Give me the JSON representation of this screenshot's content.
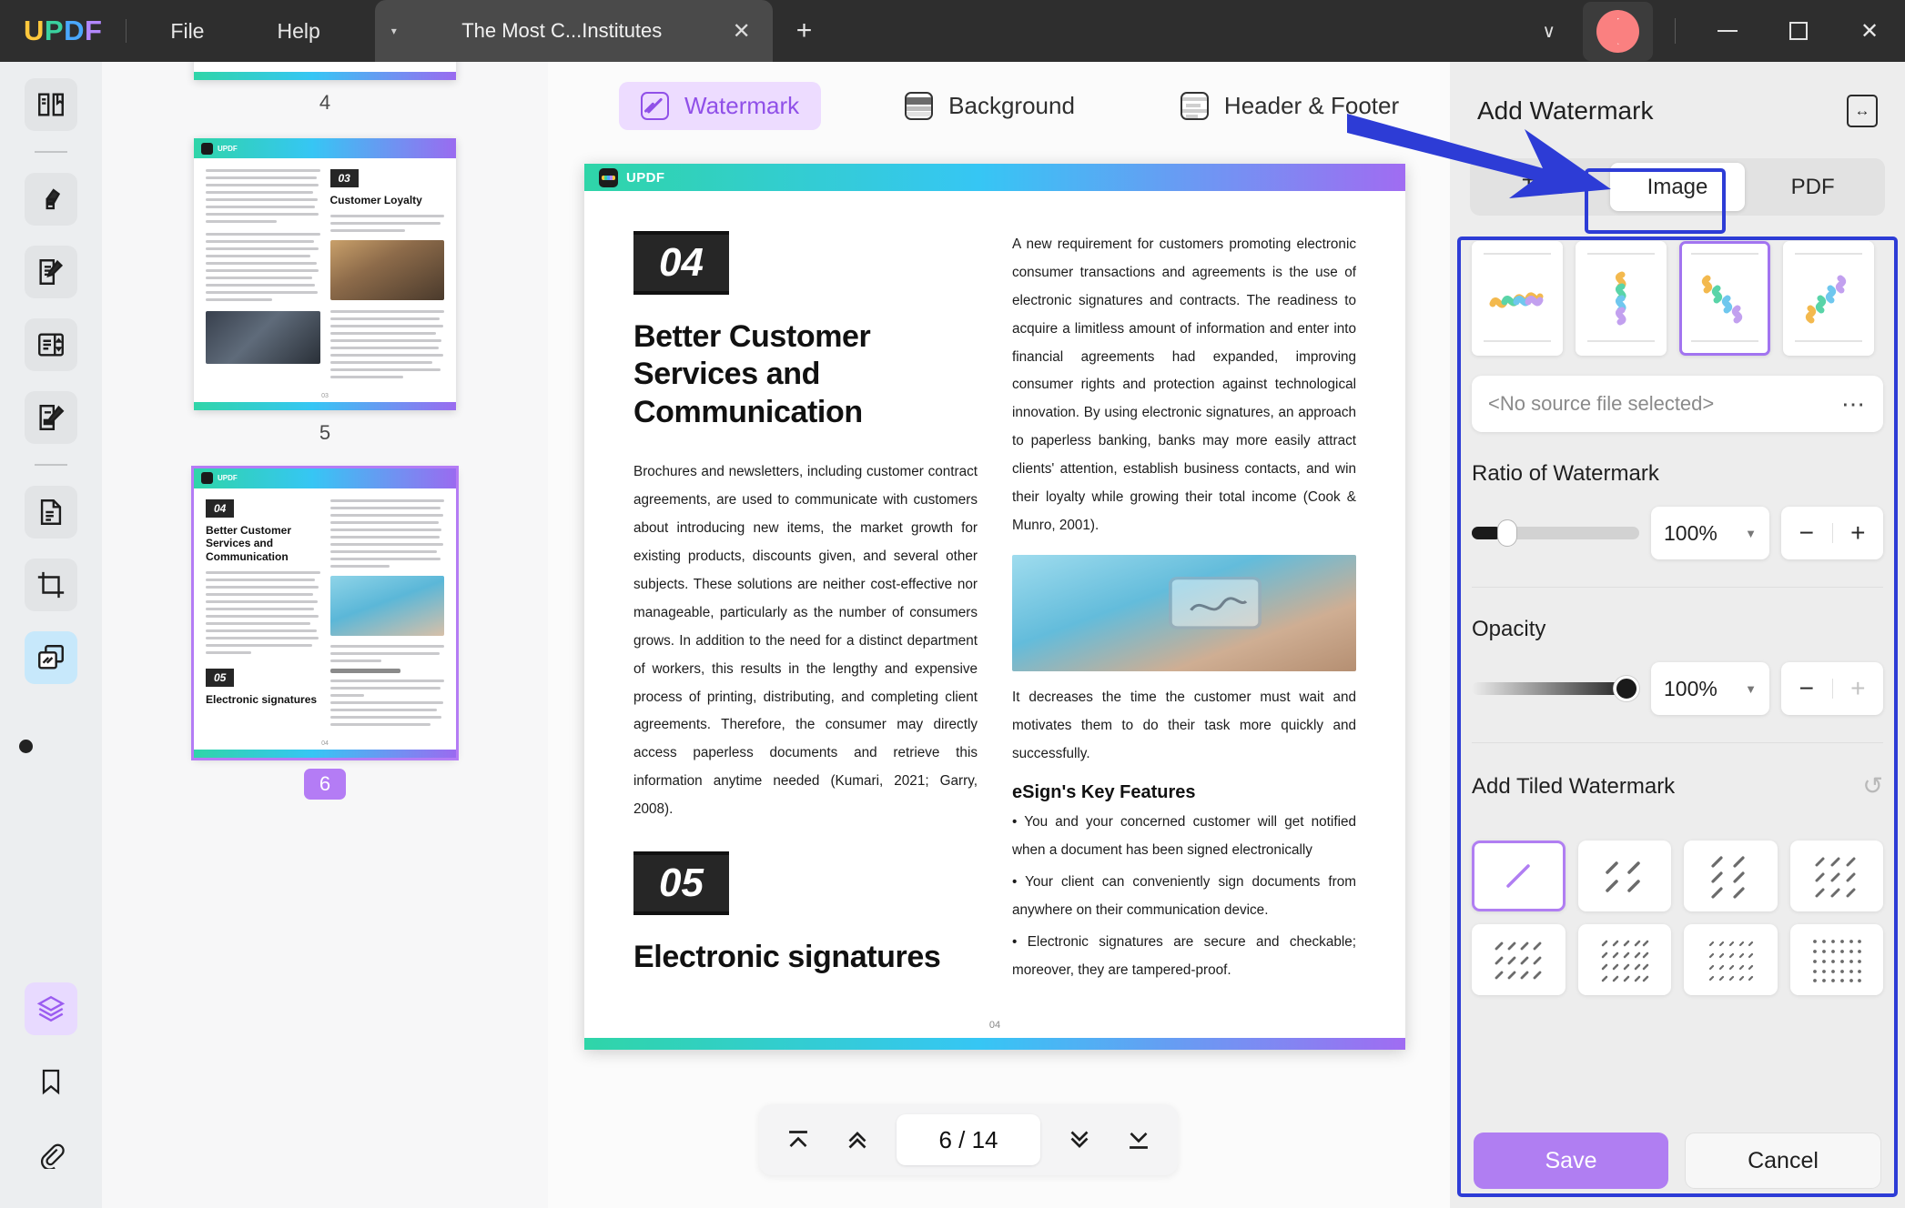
{
  "titlebar": {
    "logo": "UPDF",
    "menus": [
      "File",
      "Help"
    ],
    "tab": {
      "title": "The Most C...Institutes",
      "close": "✕",
      "caret": "▾"
    },
    "new_tab": "+",
    "chevron": "∨",
    "minimize": "—",
    "maximize": "□",
    "close": "✕"
  },
  "rail": {
    "items": [
      {
        "name": "reader-tool",
        "state": "idle"
      },
      {
        "name": "annotate-tool",
        "state": "idle"
      },
      {
        "name": "edit-pdf-tool",
        "state": "idle"
      },
      {
        "name": "form-tool",
        "state": "idle"
      },
      {
        "name": "sign-tool",
        "state": "idle"
      },
      {
        "name": "ocr-tool",
        "state": "idle"
      },
      {
        "name": "crop-tool",
        "state": "idle"
      },
      {
        "name": "page-watermark-tool",
        "state": "active"
      },
      {
        "name": "layers-tool",
        "state": "active"
      },
      {
        "name": "bookmark-tool",
        "state": "idle"
      },
      {
        "name": "attachment-tool",
        "state": "idle"
      }
    ]
  },
  "thumbnails": {
    "pages": [
      {
        "number": "4",
        "selected": false
      },
      {
        "number": "5",
        "selected": false,
        "badge": "03",
        "heading": "Customer Loyalty"
      },
      {
        "number": "6",
        "selected": true,
        "badge": "04",
        "heading": "Better Customer Services and Communication",
        "badge2": "05",
        "heading2": "Electronic signatures"
      }
    ]
  },
  "modebar": {
    "tabs": [
      {
        "label": "Watermark",
        "icon": "watermark-icon",
        "active": true
      },
      {
        "label": "Background",
        "icon": "background-icon",
        "active": false
      },
      {
        "label": "Header & Footer",
        "icon": "header-footer-icon",
        "active": false
      }
    ]
  },
  "document": {
    "brand": "UPDF",
    "left": {
      "badge": "04",
      "heading": "Better Customer Services and Communication",
      "paragraph": "Brochures and newsletters, including customer contract agreements, are used to communicate with customers about introducing new items, the market growth for existing products, discounts given, and several other subjects. These solutions are neither cost-effective nor manageable, particularly as the number of consumers grows. In addition to the need for a distinct department of workers, this results in the lengthy and expensive process of printing, distributing, and completing client agreements. Therefore, the consumer may directly access paperless documents and retrieve this information anytime needed (Kumari, 2021; Garry, 2008).",
      "badge2": "05",
      "heading2": "Electronic signatures"
    },
    "right": {
      "paragraph": "A new requirement for customers promoting electronic consumer transactions and agreements is the use of electronic signatures and contracts. The readiness to acquire a limitless amount of information and enter into financial agreements had expanded, improving consumer rights and protection against technological innovation. By using electronic signatures, an approach to paperless banking, banks may more easily attract clients' attention, establish business contacts, and win their loyalty while growing their total income (Cook & Munro, 2001).",
      "paragraph2": "It decreases the time the customer must wait and motivates them to do their task more quickly and successfully.",
      "subheading": "eSign's Key Features",
      "bullets": [
        "• You and your concerned customer will get notified when a document has been signed electronically",
        "• Your client can conveniently sign documents from anywhere on their communication device.",
        "• Electronic signatures are secure and checkable; moreover, they are tampered-proof."
      ]
    },
    "page_footer": "04"
  },
  "pager": {
    "first": "first-page-icon",
    "prev": "prev-page-icon",
    "value": "6 / 14",
    "next": "next-page-icon",
    "last": "last-page-icon"
  },
  "panel": {
    "title": "Add Watermark",
    "expand_icon": "expand-panel-icon",
    "tabs": [
      {
        "label": "Text",
        "active": false
      },
      {
        "label": "Image",
        "active": true
      },
      {
        "label": "PDF",
        "active": false
      }
    ],
    "presets": [
      {
        "name": "horizontal-squiggle",
        "selected": false
      },
      {
        "name": "vertical-squiggle",
        "selected": false
      },
      {
        "name": "diagonal-down-squiggle",
        "selected": true
      },
      {
        "name": "diagonal-up-squiggle",
        "selected": false
      }
    ],
    "source": {
      "value": "<No source file selected>",
      "more": "…"
    },
    "ratio": {
      "label": "Ratio of Watermark",
      "value": "100%",
      "slider_percent": 18,
      "minus": "−",
      "plus": "+"
    },
    "opacity": {
      "label": "Opacity",
      "value": "100%",
      "slider_percent": 100,
      "minus": "−",
      "plus": "+"
    },
    "tiled": {
      "label": "Add Tiled Watermark",
      "reset_icon": "reset-icon",
      "options": [
        {
          "name": "tile-single",
          "cols": 1,
          "rows": 1,
          "size": 34,
          "selected": true
        },
        {
          "name": "tile-2x2",
          "cols": 2,
          "rows": 2,
          "size": 12,
          "selected": false
        },
        {
          "name": "tile-2x3",
          "cols": 2,
          "rows": 3,
          "size": 11,
          "selected": false
        },
        {
          "name": "tile-3x3",
          "cols": 3,
          "rows": 3,
          "size": 9,
          "selected": false
        },
        {
          "name": "tile-4x3",
          "cols": 4,
          "rows": 3,
          "size": 8,
          "selected": false
        },
        {
          "name": "tile-5x4",
          "cols": 5,
          "rows": 4,
          "size": 6,
          "selected": false
        },
        {
          "name": "tile-5x4-small",
          "cols": 5,
          "rows": 4,
          "size": 4,
          "selected": false
        },
        {
          "name": "tile-6x5",
          "cols": 6,
          "rows": 5,
          "size": 3,
          "selected": false
        }
      ]
    },
    "save": "Save",
    "cancel": "Cancel"
  },
  "colors": {
    "accent_purple": "#b07ef2",
    "annotation_blue": "#2d3cd6",
    "active_blue": "#c7e8fb",
    "gradient_start": "#2fd5a8",
    "gradient_mid": "#36c6f4",
    "gradient_end": "#a06cf2"
  }
}
